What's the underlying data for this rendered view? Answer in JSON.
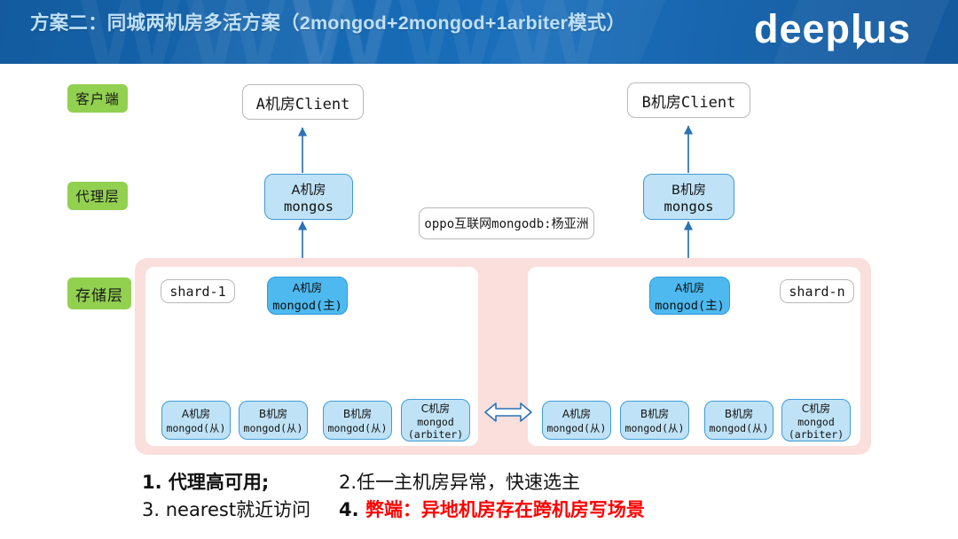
{
  "header": {
    "title": "方案二：同城两机房多活方案（2mongod+2mongod+1arbiter模式）",
    "logo_text": "deeplus",
    "watermark_text": "WWW",
    "bg_color": "#1668b2",
    "title_color": "#bfe0f7"
  },
  "layers": [
    {
      "label": "客户端",
      "name": "client"
    },
    {
      "label": "代理层",
      "name": "proxy"
    },
    {
      "label": "存储层",
      "name": "storage"
    }
  ],
  "clients": [
    {
      "label": "A机房Client"
    },
    {
      "label": "B机房Client"
    }
  ],
  "mongos": [
    {
      "line1": "A机房",
      "line2": "mongos"
    },
    {
      "line1": "B机房",
      "line2": "mongos"
    }
  ],
  "watermark_box": {
    "label": "oppo互联网mongodb:杨亚洲"
  },
  "shards": [
    {
      "label": "shard-1",
      "label_side": "left",
      "primary": {
        "line1": "A机房",
        "line2": "mongod(主)"
      },
      "members": [
        {
          "line1": "A机房",
          "line2": "mongod(从)"
        },
        {
          "line1": "B机房",
          "line2": "mongod(从)"
        },
        {
          "line1": "B机房",
          "line2": "mongod(从)"
        },
        {
          "line1": "C机房",
          "line2": "mongod",
          "line3": "(arbiter)"
        }
      ]
    },
    {
      "label": "shard-n",
      "label_side": "right",
      "primary": {
        "line1": "A机房",
        "line2": "mongod(主)"
      },
      "members": [
        {
          "line1": "A机房",
          "line2": "mongod(从)"
        },
        {
          "line1": "B机房",
          "line2": "mongod(从)"
        },
        {
          "line1": "B机房",
          "line2": "mongod(从)"
        },
        {
          "line1": "C机房",
          "line2": "mongod",
          "line3": "(arbiter)"
        }
      ]
    }
  ],
  "shard_link_icon": "double-arrow-horizontal",
  "notes": {
    "item1": "1. 代理高可用;",
    "item2": "2.任一主机房异常，快速选主",
    "item3": "3. nearest就近访问",
    "item4_prefix": "4. ",
    "item4": "弊端：异地机房存在跨机房写场景"
  },
  "colors": {
    "tag_green": "#92d050",
    "box_blue_light": "#bfe2f6",
    "box_blue_strong": "#4db9ef",
    "storage_pink": "#fadfdc",
    "arrow_blue": "#2b72b8",
    "note_red": "#ff0000"
  }
}
